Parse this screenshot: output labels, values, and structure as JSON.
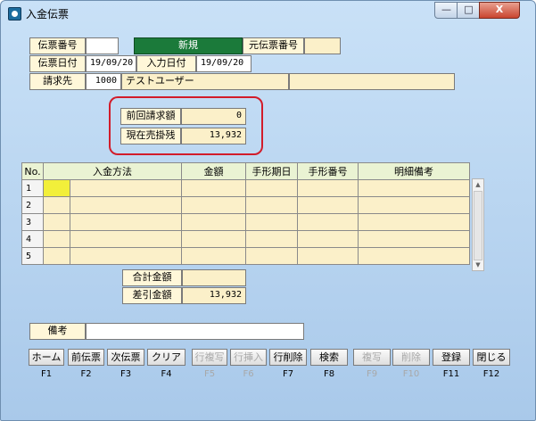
{
  "window": {
    "title": "入金伝票",
    "min": "—",
    "max": "□",
    "close": "X"
  },
  "header": {
    "denpyo_bango_label": "伝票番号",
    "denpyo_bango_value": "",
    "mode_label": "新規",
    "moto_denpyo_label": "元伝票番号",
    "moto_denpyo_value": "",
    "denpyo_hiduke_label": "伝票日付",
    "denpyo_hiduke_value": "19/09/20",
    "nyukin_hiduke_label": "入力日付",
    "nyukin_hiduke_value": "19/09/20",
    "seikyusaki_label": "請求先",
    "seikyusaki_code": "1000",
    "seikyusaki_name": "テストユーザー"
  },
  "balances": {
    "zenkai_label": "前回請求額",
    "zenkai_value": "0",
    "genzai_label": "現在売掛残",
    "genzai_value": "13,932"
  },
  "grid": {
    "headers": [
      "No.",
      "入金方法",
      "金額",
      "手形期日",
      "手形番号",
      "明細備考"
    ],
    "rows": [
      "1",
      "2",
      "3",
      "4",
      "5"
    ]
  },
  "totals": {
    "gokei_label": "合計金額",
    "gokei_value": "",
    "sashihiki_label": "差引金額",
    "sashihiki_value": "13,932"
  },
  "memo": {
    "label": "備考",
    "value": ""
  },
  "buttons": [
    {
      "label": "ホーム",
      "key": "F1",
      "enabled": true
    },
    {
      "label": "前伝票",
      "key": "F2",
      "enabled": true
    },
    {
      "label": "次伝票",
      "key": "F3",
      "enabled": true
    },
    {
      "label": "クリア",
      "key": "F4",
      "enabled": true
    },
    {
      "label": "行複写",
      "key": "F5",
      "enabled": false
    },
    {
      "label": "行挿入",
      "key": "F6",
      "enabled": false
    },
    {
      "label": "行削除",
      "key": "F7",
      "enabled": true
    },
    {
      "label": "検索",
      "key": "F8",
      "enabled": true
    },
    {
      "label": "複写",
      "key": "F9",
      "enabled": false
    },
    {
      "label": "削除",
      "key": "F10",
      "enabled": false
    },
    {
      "label": "登録",
      "key": "F11",
      "enabled": true
    },
    {
      "label": "閉じる",
      "key": "F12",
      "enabled": true
    }
  ],
  "colors": {
    "label_bg": "#fff7d9",
    "value_bg": "#fbf0c9",
    "mode_bg": "#1b7a3a",
    "highlight": "#d21c2a",
    "selected_cell": "#f2ef3a"
  }
}
